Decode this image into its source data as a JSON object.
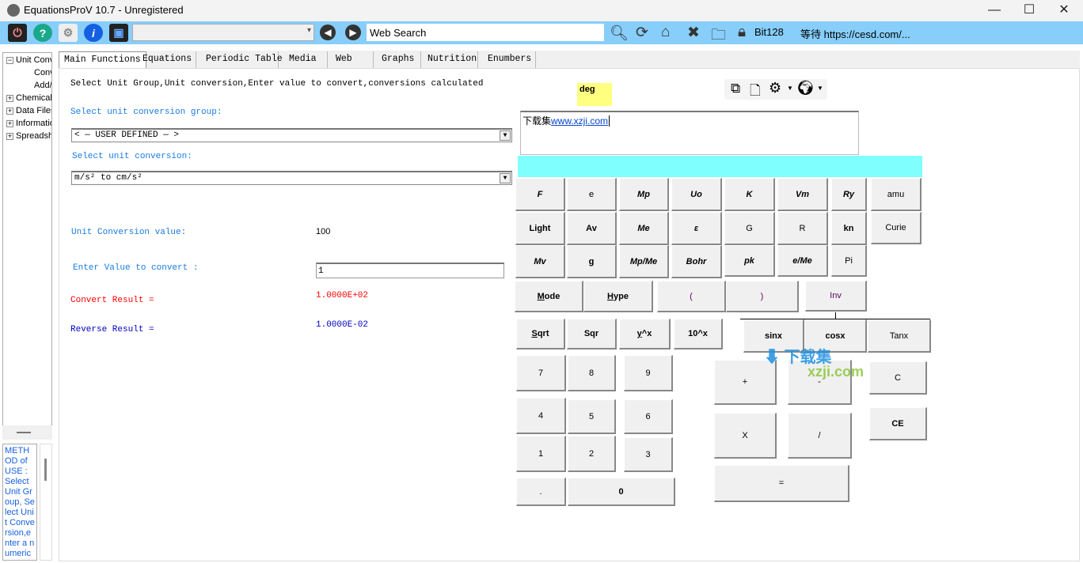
{
  "window": {
    "title": "EquationsProV 10.7 - Unregistered",
    "minimize": "—",
    "maximize": "☐",
    "close": "✕"
  },
  "toolbar": {
    "icons": [
      "power-icon",
      "help-icon",
      "settings-gears-icon",
      "info-icon",
      "tablet-icon"
    ],
    "combo_value": "",
    "web_search": "Web Search",
    "security": "Bit128",
    "status": "等待 https://cesd.com/..."
  },
  "tree": {
    "items": [
      {
        "label": "Unit Conversions",
        "sign": "−"
      },
      {
        "label": "Convert"
      },
      {
        "label": "Add/Edit"
      },
      {
        "label": "Chemical",
        "sign": "+"
      },
      {
        "label": "Data Files",
        "sign": "+"
      },
      {
        "label": "Information",
        "sign": "+"
      },
      {
        "label": "Spreadsheet",
        "sign": "+"
      }
    ]
  },
  "help_text": "METHOD of USE : Select Unit Group, Select Unit Conversion,enter a numeric",
  "tabs": [
    "Main Functions",
    "Equations",
    "Periodic Table",
    "Media",
    "Web",
    "Graphs",
    "Nutrition",
    "Enumbers"
  ],
  "main": {
    "instruction": "Select Unit Group,Unit conversion,Enter value to convert,conversions calculated",
    "group_label": "Select unit conversion group:",
    "group_value": "< — USER DEFINED — >",
    "conversion_label": "Select unit conversion:",
    "conversion_value": "m/s² to cm/s²",
    "factor_label": "Unit Conversion value:",
    "factor_value": "100",
    "enter_label": "Enter Value to convert :",
    "enter_value": "1",
    "convert_label": "Convert Result =",
    "convert_value": "1.0000E+02",
    "reverse_label": "Reverse Result =",
    "reverse_value": "1.0000E-02"
  },
  "calculator": {
    "angle_mode": "deg",
    "display_prefix": "下载集",
    "display_link": "www.xzji.com",
    "buttons": [
      "F",
      "e",
      "Mp",
      "Uo",
      "K",
      "Vm",
      "Ry",
      "amu",
      "Light",
      "Av",
      "Me",
      "ε",
      "G",
      "R",
      "kn",
      "Curie",
      "Mv",
      "g",
      "Mp/Me",
      "Bohr",
      "pk",
      "e/Me",
      "Pi",
      "Mode",
      "Hype",
      "(",
      ")",
      "Inv",
      "Sqrt",
      "Sqr",
      "y^x",
      "10^x",
      "sinx",
      "cosx",
      "Tanx",
      "7",
      "8",
      "9",
      "4",
      "5",
      "6",
      "1",
      "2",
      "3",
      ".",
      "0",
      "+",
      "-",
      "C",
      "X",
      "/",
      "CE",
      "="
    ]
  },
  "watermark": {
    "text": "下载集",
    "sub": "xzji.com"
  },
  "colors": {
    "toolbar": "#87cefa",
    "label_blue": "#1a7be0",
    "convert_red": "#ff0000",
    "reverse_blue": "#0000c0",
    "display_bar": "#80ffff",
    "deg_bg": "#ffff80"
  }
}
